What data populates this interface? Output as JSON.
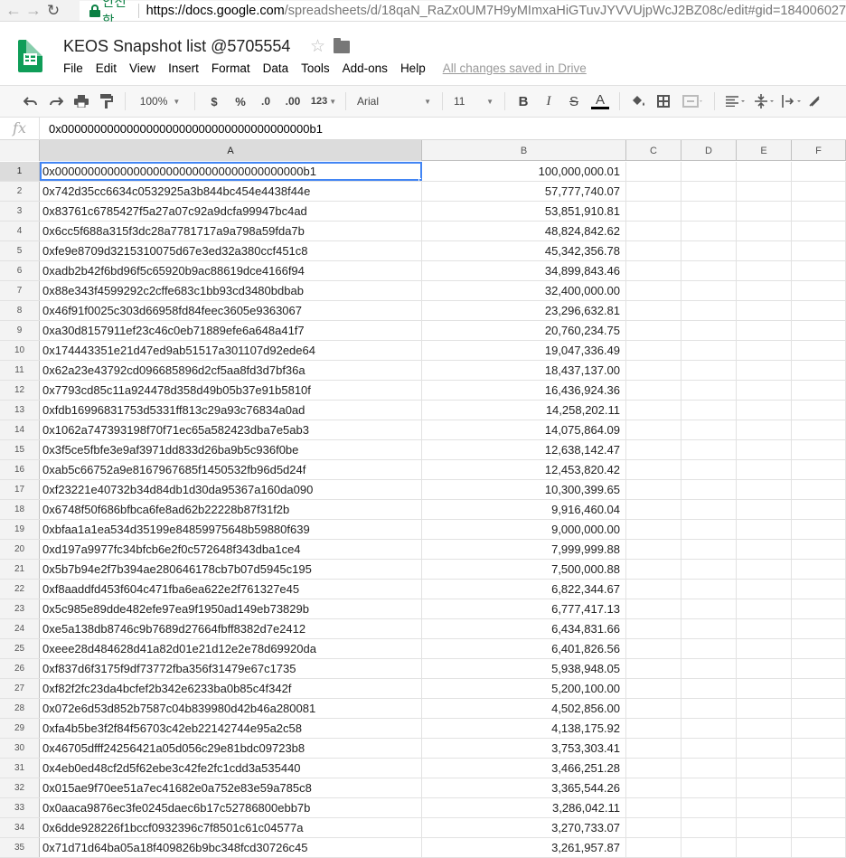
{
  "browser": {
    "secure_label": "안전함",
    "url_host": "https://docs.google.com",
    "url_path": "/spreadsheets/d/18qaN_RaZx0UM7H9yMImxaHiGTuvJYVVUjpWcJ2BZ08c/edit#gid=184006027"
  },
  "doc": {
    "title": "KEOS Snapshot list @5705554",
    "save_status": "All changes saved in Drive"
  },
  "menu": [
    "File",
    "Edit",
    "View",
    "Insert",
    "Format",
    "Data",
    "Tools",
    "Add-ons",
    "Help"
  ],
  "toolbar": {
    "zoom": "100%",
    "currency": "$",
    "percent": "%",
    "dec_decrease": ".0",
    "dec_increase": ".00",
    "more_formats": "123",
    "font": "Arial",
    "font_size": "11",
    "bold": "B",
    "italic": "I",
    "strike": "S",
    "text_color": "A"
  },
  "formula_bar": {
    "fx": "fx",
    "value": "0x00000000000000000000000000000000000000b1"
  },
  "columns": [
    "A",
    "B",
    "C",
    "D",
    "E",
    "F"
  ],
  "rows": [
    {
      "n": "1",
      "a": "0x00000000000000000000000000000000000000b1",
      "b": "100,000,000.01"
    },
    {
      "n": "2",
      "a": "0x742d35cc6634c0532925a3b844bc454e4438f44e",
      "b": "57,777,740.07"
    },
    {
      "n": "3",
      "a": "0x83761c6785427f5a27a07c92a9dcfa99947bc4ad",
      "b": "53,851,910.81"
    },
    {
      "n": "4",
      "a": "0x6cc5f688a315f3dc28a7781717a9a798a59fda7b",
      "b": "48,824,842.62"
    },
    {
      "n": "5",
      "a": "0xfe9e8709d3215310075d67e3ed32a380ccf451c8",
      "b": "45,342,356.78"
    },
    {
      "n": "6",
      "a": "0xadb2b42f6bd96f5c65920b9ac88619dce4166f94",
      "b": "34,899,843.46"
    },
    {
      "n": "7",
      "a": "0x88e343f4599292c2cffe683c1bb93cd3480bdbab",
      "b": "32,400,000.00"
    },
    {
      "n": "8",
      "a": "0x46f91f0025c303d66958fd84feec3605e9363067",
      "b": "23,296,632.81"
    },
    {
      "n": "9",
      "a": "0xa30d8157911ef23c46c0eb71889efe6a648a41f7",
      "b": "20,760,234.75"
    },
    {
      "n": "10",
      "a": "0x174443351e21d47ed9ab51517a301107d92ede64",
      "b": "19,047,336.49"
    },
    {
      "n": "11",
      "a": "0x62a23e43792cd096685896d2cf5aa8fd3d7bf36a",
      "b": "18,437,137.00"
    },
    {
      "n": "12",
      "a": "0x7793cd85c11a924478d358d49b05b37e91b5810f",
      "b": "16,436,924.36"
    },
    {
      "n": "13",
      "a": "0xfdb16996831753d5331ff813c29a93c76834a0ad",
      "b": "14,258,202.11"
    },
    {
      "n": "14",
      "a": "0x1062a747393198f70f71ec65a582423dba7e5ab3",
      "b": "14,075,864.09"
    },
    {
      "n": "15",
      "a": "0x3f5ce5fbfe3e9af3971dd833d26ba9b5c936f0be",
      "b": "12,638,142.47"
    },
    {
      "n": "16",
      "a": "0xab5c66752a9e8167967685f1450532fb96d5d24f",
      "b": "12,453,820.42"
    },
    {
      "n": "17",
      "a": "0xf23221e40732b34d84db1d30da95367a160da090",
      "b": "10,300,399.65"
    },
    {
      "n": "18",
      "a": "0x6748f50f686bfbca6fe8ad62b22228b87f31f2b",
      "b": "9,916,460.04"
    },
    {
      "n": "19",
      "a": "0xbfaa1a1ea534d35199e84859975648b59880f639",
      "b": "9,000,000.00"
    },
    {
      "n": "20",
      "a": "0xd197a9977fc34bfcb6e2f0c572648f343dba1ce4",
      "b": "7,999,999.88"
    },
    {
      "n": "21",
      "a": "0x5b7b94e2f7b394ae280646178cb7b07d5945c195",
      "b": "7,500,000.88"
    },
    {
      "n": "22",
      "a": "0xf8aaddfd453f604c471fba6ea622e2f761327e45",
      "b": "6,822,344.67"
    },
    {
      "n": "23",
      "a": "0x5c985e89dde482efe97ea9f1950ad149eb73829b",
      "b": "6,777,417.13"
    },
    {
      "n": "24",
      "a": "0xe5a138db8746c9b7689d27664fbff8382d7e2412",
      "b": "6,434,831.66"
    },
    {
      "n": "25",
      "a": "0xeee28d484628d41a82d01e21d12e2e78d69920da",
      "b": "6,401,826.56"
    },
    {
      "n": "26",
      "a": "0xf837d6f3175f9df73772fba356f31479e67c1735",
      "b": "5,938,948.05"
    },
    {
      "n": "27",
      "a": "0xf82f2fc23da4bcfef2b342e6233ba0b85c4f342f",
      "b": "5,200,100.00"
    },
    {
      "n": "28",
      "a": "0x072e6d53d852b7587c04b839980d42b46a280081",
      "b": "4,502,856.00"
    },
    {
      "n": "29",
      "a": "0xfa4b5be3f2f84f56703c42eb22142744e95a2c58",
      "b": "4,138,175.92"
    },
    {
      "n": "30",
      "a": "0x46705dfff24256421a05d056c29e81bdc09723b8",
      "b": "3,753,303.41"
    },
    {
      "n": "31",
      "a": "0x4eb0ed48cf2d5f62ebe3c42fe2fc1cdd3a535440",
      "b": "3,466,251.28"
    },
    {
      "n": "32",
      "a": "0x015ae9f70ee51a7ec41682e0a752e83e59a785c8",
      "b": "3,365,544.26"
    },
    {
      "n": "33",
      "a": "0x0aaca9876ec3fe0245daec6b17c52786800ebb7b",
      "b": "3,286,042.11"
    },
    {
      "n": "34",
      "a": "0x6dde928226f1bccf0932396c7f8501c61c04577a",
      "b": "3,270,733.07"
    },
    {
      "n": "35",
      "a": "0x71d71d64ba05a18f409826b9bc348fcd30726c45",
      "b": "3,261,957.87"
    }
  ],
  "selection": {
    "row": "1",
    "column": "A"
  },
  "colors": {
    "sheets_green": "#0f9d58",
    "selection_blue": "#4285f4",
    "secure_green": "#0b8043"
  }
}
